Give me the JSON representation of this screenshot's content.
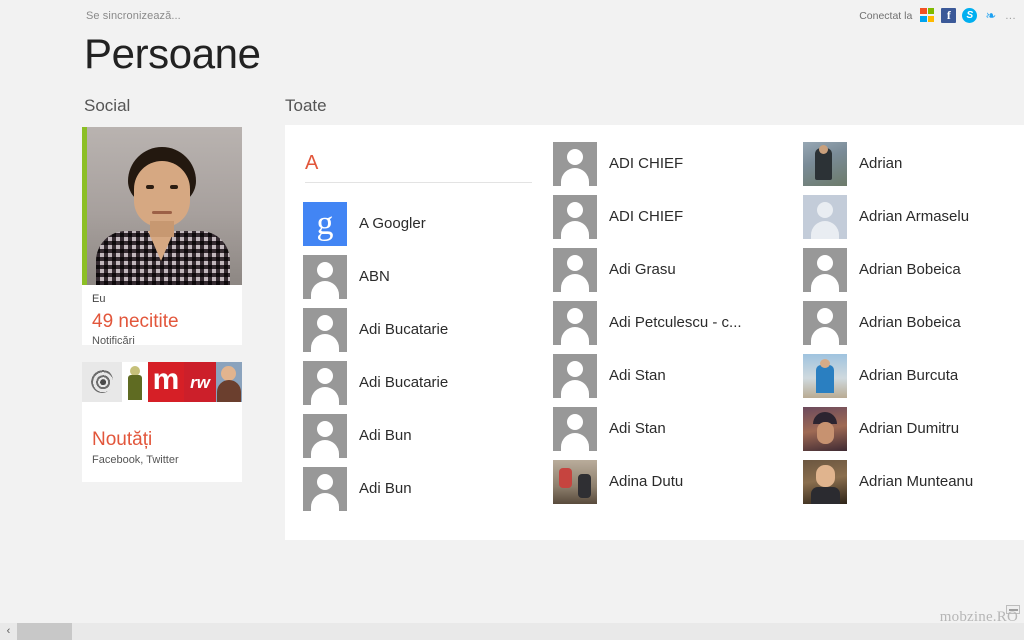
{
  "statusbar": {
    "sync_text": "Se sincronizează...",
    "connected_label": "Conectat la",
    "services": [
      {
        "name": "microsoft-icon",
        "label": "Microsoft"
      },
      {
        "name": "facebook-icon",
        "label": "f"
      },
      {
        "name": "skype-icon",
        "label": "S"
      },
      {
        "name": "twitter-icon",
        "label": "❧"
      }
    ],
    "more_label": "..."
  },
  "page_title": "Persoane",
  "sections": {
    "social_header": "Social",
    "all_header": "Toate"
  },
  "social_tiles": [
    {
      "name": "Eu",
      "count_text": "49 necitite",
      "subtitle": "Notificări",
      "accent_color": "#8cbf26"
    },
    {
      "title": "Noutăți",
      "subtitle": "Facebook, Twitter"
    }
  ],
  "contacts": {
    "group_letter": "A",
    "columns": [
      {
        "items": [
          {
            "name": "A Googler",
            "avatar": "google"
          },
          {
            "name": "ABN",
            "avatar": "placeholder"
          },
          {
            "name": "Adi Bucatarie",
            "avatar": "placeholder"
          },
          {
            "name": "Adi Bucatarie",
            "avatar": "placeholder"
          },
          {
            "name": "Adi Bun",
            "avatar": "placeholder"
          },
          {
            "name": "Adi Bun",
            "avatar": "placeholder"
          }
        ]
      },
      {
        "items": [
          {
            "name": "ADI CHIEF",
            "avatar": "placeholder"
          },
          {
            "name": "ADI CHIEF",
            "avatar": "placeholder"
          },
          {
            "name": "Adi Grasu",
            "avatar": "placeholder"
          },
          {
            "name": "Adi Petculescu - c...",
            "avatar": "placeholder"
          },
          {
            "name": "Adi Stan",
            "avatar": "placeholder"
          },
          {
            "name": "Adi Stan",
            "avatar": "placeholder"
          },
          {
            "name": "Adina Dutu",
            "avatar": "photo5"
          }
        ]
      },
      {
        "items": [
          {
            "name": "Adrian",
            "avatar": "photo1"
          },
          {
            "name": "Adrian Armaselu",
            "avatar": "placeholder-blue"
          },
          {
            "name": "Adrian Bobeica",
            "avatar": "placeholder"
          },
          {
            "name": "Adrian Bobeica",
            "avatar": "placeholder"
          },
          {
            "name": "Adrian Burcuta",
            "avatar": "photo2"
          },
          {
            "name": "Adrian Dumitru",
            "avatar": "photo3"
          },
          {
            "name": "Adrian Munteanu",
            "avatar": "photo4"
          }
        ]
      }
    ]
  },
  "scrollbar": {
    "left_arrow": "‹"
  },
  "watermark": "mobzine.RO",
  "colors": {
    "accent_orange": "#e2563b",
    "green": "#8cbf26",
    "page_bg": "#f2f2f2",
    "panel_bg": "#ffffff"
  }
}
